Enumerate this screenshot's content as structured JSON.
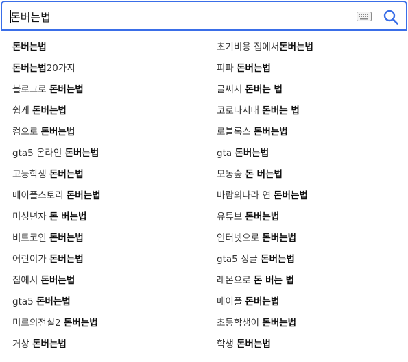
{
  "search": {
    "value": "돈버는법",
    "placeholder": ""
  },
  "icons": {
    "keyboard": "keyboard-icon",
    "search": "search-icon"
  },
  "colors": {
    "accent": "#3a6ee8"
  },
  "suggestions_left": [
    {
      "prefix": "",
      "rest": "돈버는법"
    },
    {
      "prefix": "",
      "rest": "돈버는법",
      "suffix": "20가지"
    },
    {
      "prefix": "블로그로 ",
      "rest": "돈버는법"
    },
    {
      "prefix": "쉽게 ",
      "rest": "돈버는법"
    },
    {
      "prefix": "컴으로 ",
      "rest": "돈버는법"
    },
    {
      "prefix": "gta5 온라인 ",
      "rest": "돈버는법"
    },
    {
      "prefix": "고등학생 ",
      "rest": "돈버는법"
    },
    {
      "prefix": "메이플스토리 ",
      "rest": "돈버는법"
    },
    {
      "prefix": "미성년자 ",
      "rest": "돈 버는법"
    },
    {
      "prefix": "비트코인 ",
      "rest": "돈버는법"
    },
    {
      "prefix": "어린이가 ",
      "rest": "돈버는법"
    },
    {
      "prefix": "집에서 ",
      "rest": "돈버는법"
    },
    {
      "prefix": "gta5 ",
      "rest": "돈버는법"
    },
    {
      "prefix": "미르의전설2 ",
      "rest": "돈버는법"
    },
    {
      "prefix": "거상 ",
      "rest": "돈버는법"
    }
  ],
  "suggestions_right": [
    {
      "prefix": "초기비용 집에서",
      "rest": "돈버는법"
    },
    {
      "prefix": "피파 ",
      "rest": "돈버는법"
    },
    {
      "prefix": "글써서 ",
      "rest": "돈버는 법"
    },
    {
      "prefix": "코로나시대 ",
      "rest": "돈버는 법"
    },
    {
      "prefix": "로블록스 ",
      "rest": "돈버는법"
    },
    {
      "prefix": "gta ",
      "rest": "돈버는법"
    },
    {
      "prefix": "모동숲 ",
      "rest": "돈 버는법"
    },
    {
      "prefix": "바람의나라 연 ",
      "rest": "돈버는법"
    },
    {
      "prefix": "유튜브 ",
      "rest": "돈버는법"
    },
    {
      "prefix": "인터넷으로 ",
      "rest": "돈버는법"
    },
    {
      "prefix": "gta5 싱글 ",
      "rest": "돈버는법"
    },
    {
      "prefix": "레몬으로 ",
      "rest": "돈 버는 법"
    },
    {
      "prefix": "메이플 ",
      "rest": "돈버는법"
    },
    {
      "prefix": "초등학생이 ",
      "rest": "돈버는법"
    },
    {
      "prefix": "학생 ",
      "rest": "돈버는법"
    }
  ]
}
